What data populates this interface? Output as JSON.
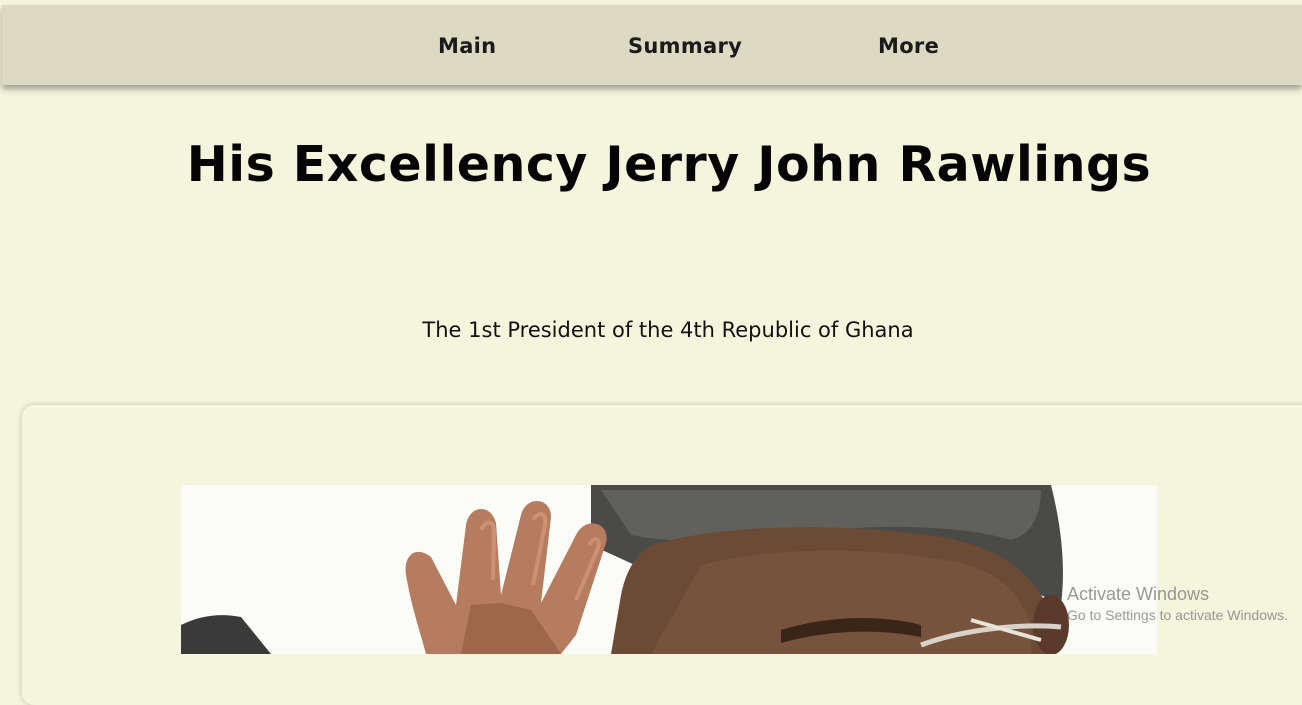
{
  "nav": {
    "items": [
      {
        "label": "Main"
      },
      {
        "label": "Summary"
      },
      {
        "label": "More"
      }
    ]
  },
  "header": {
    "title": "His Excellency Jerry John Rawlings",
    "subtitle": "The 1st President of the 4th Republic of Ghana"
  },
  "card": {
    "image_icon": "portrait-photo"
  },
  "watermark": {
    "title": "Activate Windows",
    "subtitle": "Go to Settings to activate Windows."
  },
  "colors": {
    "page_background": "#f5f4dc",
    "nav_background": "#dcdac2",
    "text": "#050505"
  }
}
